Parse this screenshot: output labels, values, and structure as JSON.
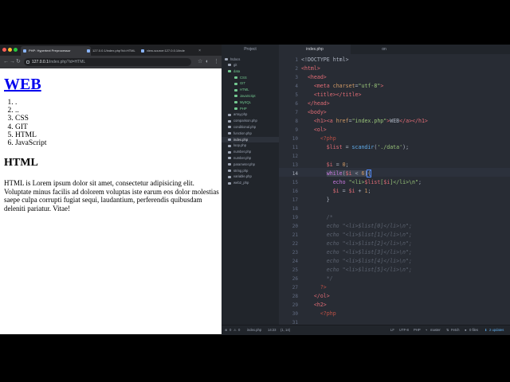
{
  "browser": {
    "tabs": [
      {
        "label": "PHP: Hypertext Preprocessor",
        "active": true
      },
      {
        "label": "127.0.0.1/index.php?id=HTML",
        "active": false
      },
      {
        "label": "view-source:127.0.0.1/inde",
        "active": false
      }
    ],
    "address": {
      "host": "127.0.0.1",
      "path": "/index.php?id=HTML"
    },
    "page": {
      "title_link": "WEB",
      "list_items": [
        ".",
        "..",
        "CSS",
        "GIT",
        "HTML",
        "JavaScript"
      ],
      "heading": "HTML",
      "paragraph": "HTML is Lorem ipsum dolor sit amet, consectetur adipisicing elit. Voluptate minus facilis ad dolorem voluptas iste earum eos dolor molestias saepe culpa corrupti fugiat sequi, laudantium, perferendis quibusdam deleniti pariatur. Vitae!"
    }
  },
  "editor": {
    "panel_tabs": [
      "Project",
      "index.php",
      "on"
    ],
    "tree": {
      "root": "htdocs",
      "items": [
        {
          "label": "git",
          "type": "folder"
        },
        {
          "label": "data",
          "type": "folder-open"
        },
        {
          "label": "CSS",
          "type": "file-green"
        },
        {
          "label": "GIT",
          "type": "file-green"
        },
        {
          "label": "HTML",
          "type": "file-green"
        },
        {
          "label": "JavaScript",
          "type": "file-green"
        },
        {
          "label": "MySQL",
          "type": "file-green"
        },
        {
          "label": "PHP",
          "type": "file-green"
        },
        {
          "label": "array.php",
          "type": "file"
        },
        {
          "label": "comparison.php",
          "type": "file"
        },
        {
          "label": "conditional.php",
          "type": "file"
        },
        {
          "label": "function.php",
          "type": "file"
        },
        {
          "label": "index.php",
          "type": "file",
          "selected": true
        },
        {
          "label": "loop.php",
          "type": "file"
        },
        {
          "label": "number.php",
          "type": "file"
        },
        {
          "label": "number.php",
          "type": "file"
        },
        {
          "label": "parameter.php",
          "type": "file"
        },
        {
          "label": "string.php",
          "type": "file"
        },
        {
          "label": "variable.php",
          "type": "file"
        },
        {
          "label": "web2_php",
          "type": "folder"
        }
      ]
    },
    "line_numbers": [
      "1",
      "2",
      "3",
      "4",
      "5",
      "6",
      "7",
      "8",
      "9",
      "10",
      "11",
      "12",
      "13",
      "14",
      "15",
      "16",
      "17",
      "18",
      "19",
      "20",
      "21",
      "22",
      "23",
      "24",
      "25",
      "26",
      "27",
      "28",
      "29",
      "30",
      "31"
    ],
    "active_line": "14",
    "status": {
      "errors": "0",
      "warnings": "0",
      "file": "index.php",
      "cursor": "14:23",
      "selection": "(1, 14)",
      "line_ending": "LF",
      "encoding": "UTF-8",
      "grammar": "PHP",
      "branch": "master",
      "fetch": "Fetch",
      "files": "0 files",
      "updates": "2 updates"
    }
  }
}
